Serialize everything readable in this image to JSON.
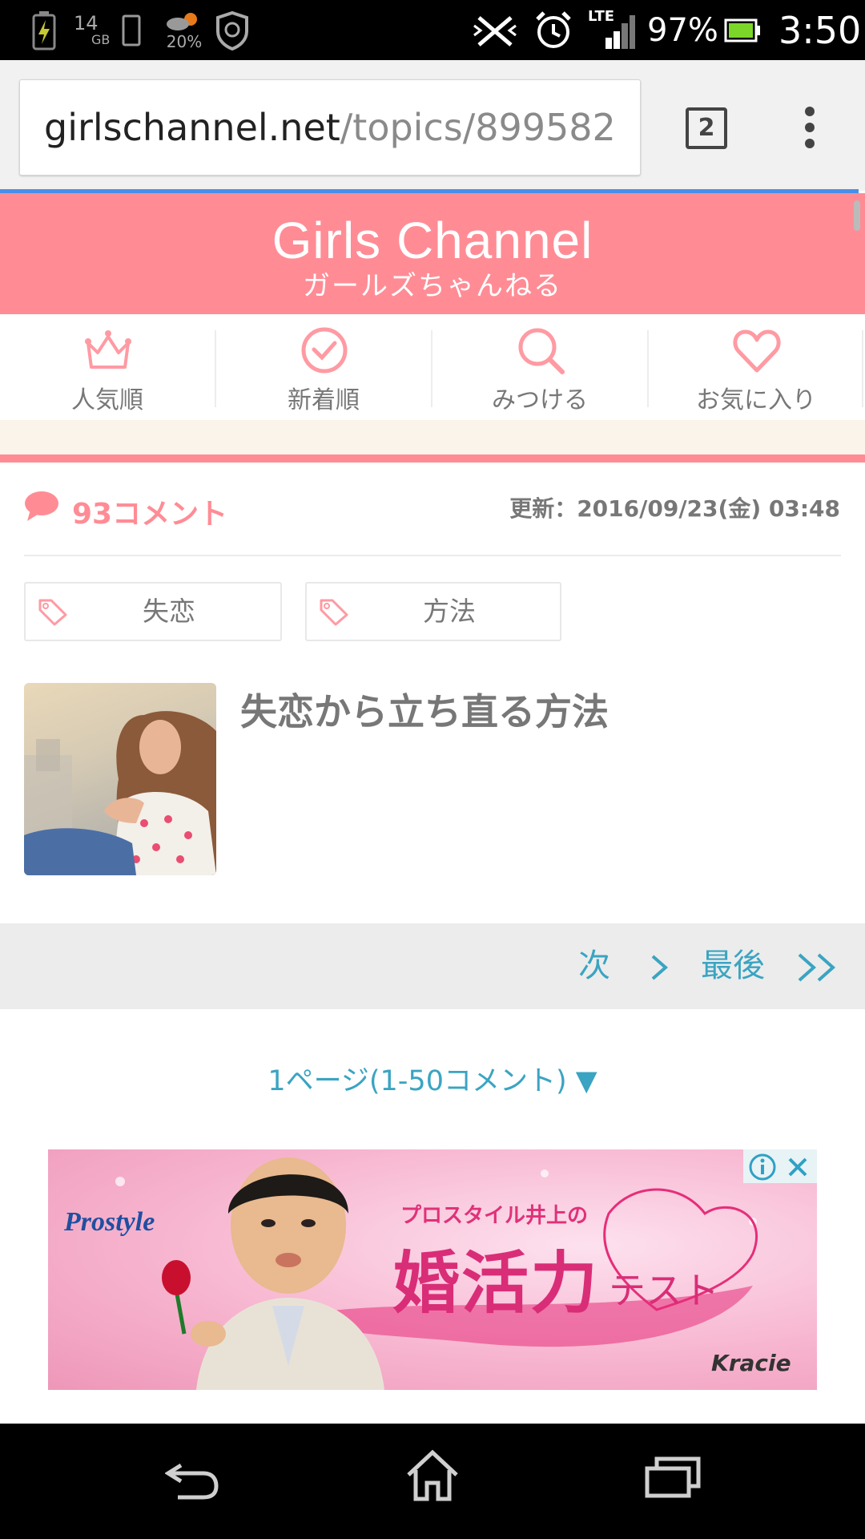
{
  "status_bar": {
    "storage_value": "14",
    "storage_unit": "GB",
    "weather_percent": "20%",
    "battery_percent": "97%",
    "time": "3:50",
    "network": "LTE"
  },
  "browser": {
    "url_domain": "girlschannel.net",
    "url_path": "/topics/899582",
    "tab_count": "2"
  },
  "site": {
    "logo_main": "Girls Channel",
    "logo_sub": "ガールズちゃんねる",
    "brand_color": "#ff8c95"
  },
  "nav": {
    "items": [
      {
        "label": "人気順",
        "icon": "crown-icon"
      },
      {
        "label": "新着順",
        "icon": "clock-icon"
      },
      {
        "label": "みつける",
        "icon": "search-icon"
      },
      {
        "label": "お気に入り",
        "icon": "heart-icon"
      }
    ]
  },
  "topic": {
    "comment_count": "93コメント",
    "updated": "更新：2016/09/23(金) 03:48",
    "tags": [
      "失恋",
      "方法"
    ],
    "title": "失恋から立ち直る方法"
  },
  "pager": {
    "next_label": "次",
    "last_label": "最後",
    "page_select": "1ページ(1-50コメント) ▼"
  },
  "ad": {
    "brand": "Prostyle",
    "subtitle": "プロスタイル井上の",
    "main_text": "婚活力",
    "test_text": "テスト",
    "sponsor": "Kracie"
  }
}
